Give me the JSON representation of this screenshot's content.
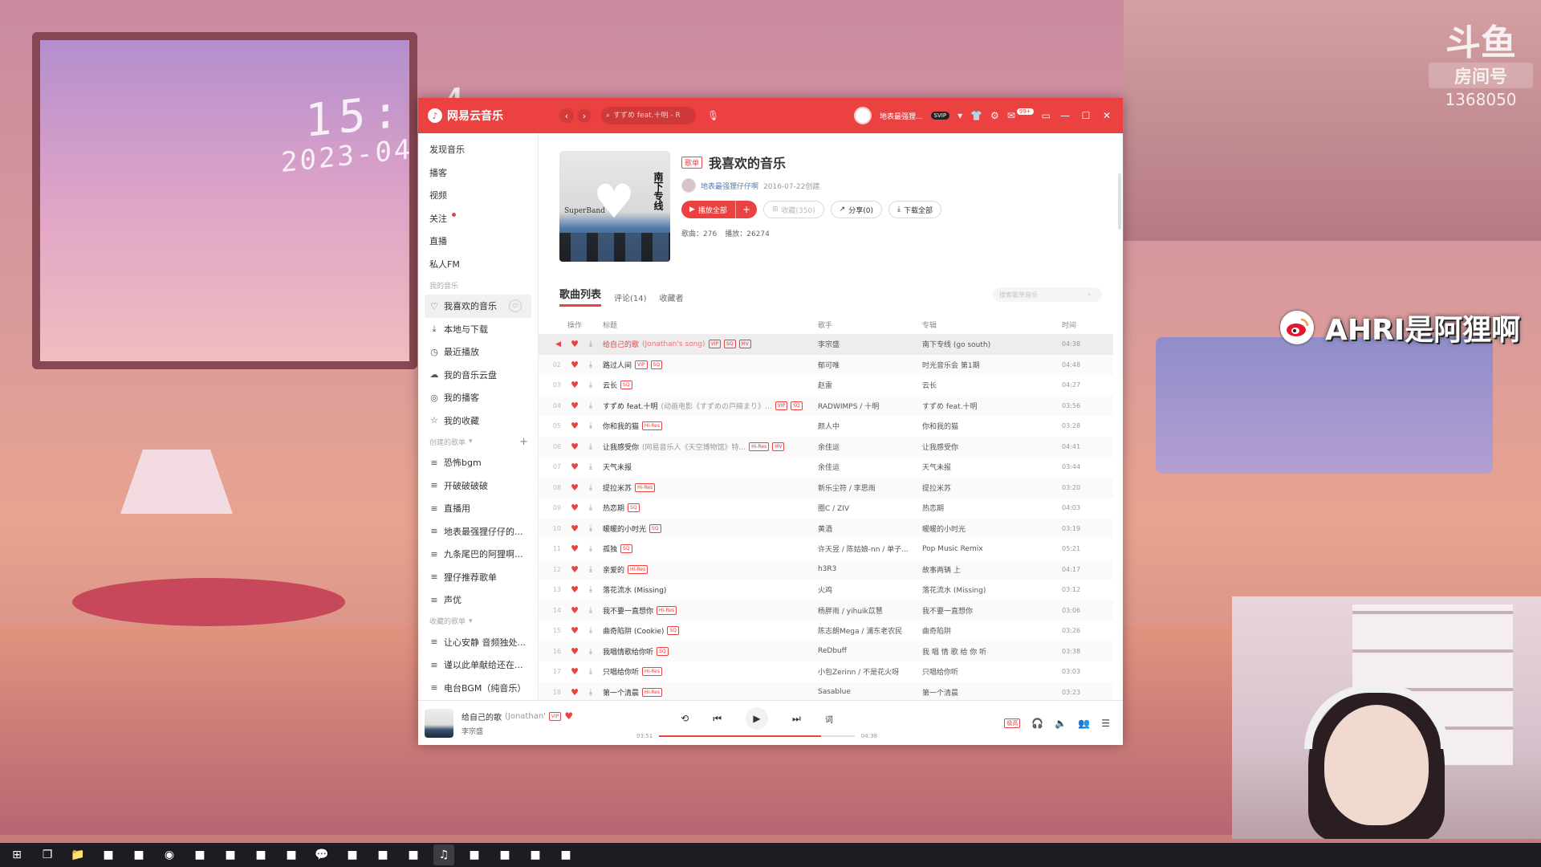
{
  "overlay": {
    "clock_time": "15: 4",
    "clock_date": "2023-04",
    "douyu_logo": "斗鱼",
    "douyu_room_label": "房间号",
    "douyu_room_number": "1368050",
    "weibo_name": "AHRI是阿狸啊"
  },
  "app": {
    "brand": "网易云音乐",
    "search_placeholder": "すずめ feat.十明 - R",
    "username": "地表最强狸...",
    "vip_badge": "SVIP",
    "message_count": "99+",
    "colors": {
      "brand_red": "#ec4141",
      "sidebar_bg": "#ffffff"
    }
  },
  "sidebar": {
    "top_items": [
      {
        "label": "发现音乐"
      },
      {
        "label": "播客"
      },
      {
        "label": "视频"
      },
      {
        "label": "关注"
      },
      {
        "label": "直播"
      },
      {
        "label": "私人FM"
      }
    ],
    "my_music_header": "我的音乐",
    "my_music": [
      {
        "label": "我喜欢的音乐",
        "icon": "heart-icon"
      },
      {
        "label": "本地与下载",
        "icon": "download-icon"
      },
      {
        "label": "最近播放",
        "icon": "clock-icon"
      },
      {
        "label": "我的音乐云盘",
        "icon": "cloud-icon"
      },
      {
        "label": "我的播客",
        "icon": "podcast-icon"
      },
      {
        "label": "我的收藏",
        "icon": "star-icon"
      }
    ],
    "created_header": "创建的歌单",
    "created": [
      {
        "label": "恐怖bgm"
      },
      {
        "label": "开破破破破"
      },
      {
        "label": "直播用"
      },
      {
        "label": "地表最强狸仔仔的..."
      },
      {
        "label": "九条尾巴的阿狸啊..."
      },
      {
        "label": "狸仔推荐歌单"
      },
      {
        "label": "声优"
      }
    ],
    "collected_header": "收藏的歌单",
    "collected": [
      {
        "label": "让心安静 音频独处..."
      },
      {
        "label": "谨以此单献给还在..."
      },
      {
        "label": "电台BGM（纯音乐）"
      }
    ]
  },
  "playlist": {
    "tag": "歌单",
    "title": "我喜欢的音乐",
    "creator": "地表最强狸仔仔啊",
    "created_date": "2016-07-22创建",
    "play_all": "播放全部",
    "collect": "收藏(350)",
    "share": "分享(0)",
    "download_all": "下载全部",
    "song_count_label": "歌曲：",
    "song_count": "276",
    "play_count_label": "播放：",
    "play_count": "26274",
    "cover_text": "南下专线",
    "cover_band": "SuperBand"
  },
  "tabs": {
    "songs": "歌曲列表",
    "comments": "评论(14)",
    "collectors": "收藏者",
    "search_placeholder": "搜索歌单音乐"
  },
  "columns": {
    "ops": "操作",
    "title": "标题",
    "artist": "歌手",
    "album": "专辑",
    "time": "时间"
  },
  "songs": [
    {
      "idx": "01",
      "title": "给自己的歌",
      "alias": "(Jonathan's song)",
      "badges": [
        "VIP",
        "SQ",
        "MV"
      ],
      "artist": "李宗盛",
      "album": "南下专线 (go south)",
      "time": "04:38",
      "playing": true
    },
    {
      "idx": "02",
      "title": "路过人间",
      "alias": "",
      "badges": [
        "VIP",
        "SQ"
      ],
      "artist": "郁可唯",
      "album": "时光音乐会 第1期",
      "time": "04:48"
    },
    {
      "idx": "03",
      "title": "云长",
      "alias": "",
      "badges": [
        "SQ"
      ],
      "artist": "赵雷",
      "album": "云长",
      "time": "04:27"
    },
    {
      "idx": "04",
      "title": "すずめ feat.十明",
      "alias": "(动画电影《すずめの戸締まり》...",
      "badges": [
        "VIP",
        "SQ"
      ],
      "artist": "RADWIMPS / 十明",
      "album": "すずめ feat.十明",
      "time": "03:56"
    },
    {
      "idx": "05",
      "title": "你和我的猫",
      "alias": "",
      "badges": [
        "Hi-Res"
      ],
      "artist": "颜人中",
      "album": "你和我的猫",
      "time": "03:28"
    },
    {
      "idx": "06",
      "title": "让我感受你",
      "alias": "(网易音乐人《天空博物馆》特...",
      "badges": [
        "Hi-Res",
        "MV"
      ],
      "artist": "余佳运",
      "album": "让我感受你",
      "time": "04:41"
    },
    {
      "idx": "07",
      "title": "天气未报",
      "alias": "",
      "badges": [],
      "artist": "余佳运",
      "album": "天气未报",
      "time": "03:44"
    },
    {
      "idx": "08",
      "title": "提拉米苏",
      "alias": "",
      "badges": [
        "Hi-Res"
      ],
      "artist": "新乐尘符 / 李思雨",
      "album": "提拉米苏",
      "time": "03:20"
    },
    {
      "idx": "09",
      "title": "热恋期",
      "alias": "",
      "badges": [
        "SQ"
      ],
      "artist": "圈C / ZIV",
      "album": "热恋期",
      "time": "04:03"
    },
    {
      "idx": "10",
      "title": "暖暖的小时光",
      "alias": "",
      "badges": [
        "SQ"
      ],
      "artist": "黄酒",
      "album": "暖暖的小时光",
      "time": "03:19"
    },
    {
      "idx": "11",
      "title": "孤独",
      "alias": "",
      "badges": [
        "SQ"
      ],
      "artist": "许天昱 / 陈姑娘-nn / 单子...",
      "album": "Pop Music Remix",
      "time": "05:21"
    },
    {
      "idx": "12",
      "title": "亲爱的",
      "alias": "",
      "badges": [
        "Hi-Res"
      ],
      "artist": "h3R3",
      "album": "故事两辆 上",
      "time": "04:17"
    },
    {
      "idx": "13",
      "title": "落花流水 (Missing)",
      "alias": "",
      "badges": [],
      "artist": "火鸡",
      "album": "落花流水 (Missing)",
      "time": "03:12"
    },
    {
      "idx": "14",
      "title": "我不要一直想你",
      "alias": "",
      "badges": [
        "Hi-Res"
      ],
      "artist": "杨胖雨 / yihuik苡慧",
      "album": "我不要一直想你",
      "time": "03:06"
    },
    {
      "idx": "15",
      "title": "曲奇陷阱 (Cookie)",
      "alias": "",
      "badges": [
        "SQ"
      ],
      "artist": "陈志朗Mega / 浦东老农民",
      "album": "曲奇陷阱",
      "time": "03:26"
    },
    {
      "idx": "16",
      "title": "我唱情歌给你听",
      "alias": "",
      "badges": [
        "SQ"
      ],
      "artist": "ReDbuff",
      "album": "我 唱 情 歌 给 你 听",
      "time": "03:38"
    },
    {
      "idx": "17",
      "title": "只唱给你听",
      "alias": "",
      "badges": [
        "Hi-Res"
      ],
      "artist": "小包Zerinn / 不是花火呀",
      "album": "只唱给你听",
      "time": "03:03"
    },
    {
      "idx": "18",
      "title": "第一个清晨",
      "alias": "",
      "badges": [
        "Hi-Res"
      ],
      "artist": "Sasablue",
      "album": "第一个清晨",
      "time": "03:23"
    }
  ],
  "player": {
    "title": "给自己的歌",
    "alias": "(Jonathan'",
    "badge": "VIP",
    "artist": "李宗盛",
    "current_time": "03:51",
    "total_time": "04:38",
    "progress": 0.83,
    "lyric_label": "词",
    "quality": "极高"
  },
  "taskbar": {
    "items": [
      "start-icon",
      "task-view-icon",
      "explorer-icon",
      "app-icon",
      "app-icon",
      "steam-icon",
      "app-icon",
      "app-icon",
      "app-icon",
      "app-icon",
      "wechat-icon",
      "app-icon",
      "app-icon",
      "app-icon",
      "netease-icon",
      "app-icon",
      "app-icon",
      "app-icon",
      "app-icon"
    ]
  }
}
